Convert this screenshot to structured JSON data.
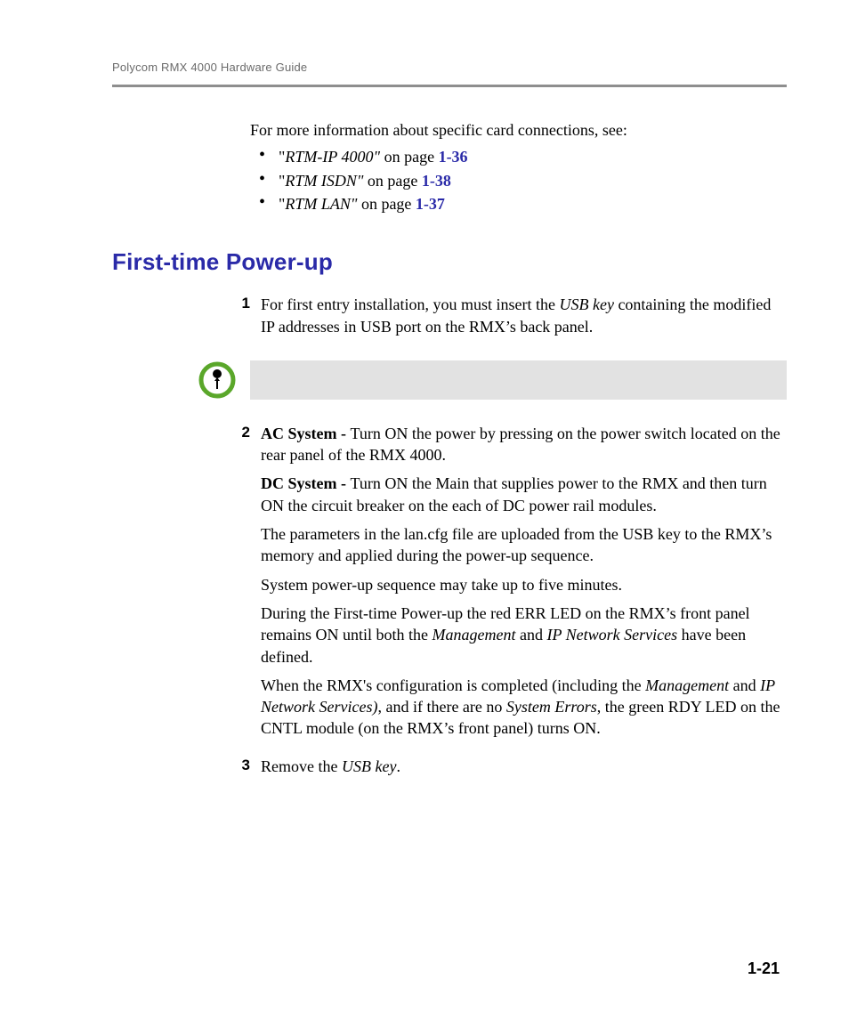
{
  "header": "Polycom RMX 4000 Hardware Guide",
  "intro": "For more information about specific card connections, see:",
  "refs": [
    {
      "prefix": "\"",
      "title": "RTM-IP 4000\"",
      "mid": " on page ",
      "page": "1-36"
    },
    {
      "prefix": "\"",
      "title": "RTM ISDN\"",
      "mid": " on page ",
      "page": "1-38"
    },
    {
      "prefix": "\"",
      "title": "RTM LAN\"",
      "mid": " on page ",
      "page": "1-37"
    }
  ],
  "heading": "First-time Power-up",
  "steps": {
    "one": {
      "num": "1",
      "a": "For first entry installation, you must insert the ",
      "b": "USB key",
      "c": " containing the modified IP addresses in USB port on the RMX’s back panel."
    },
    "two": {
      "num": "2",
      "ac_label": "AC System - ",
      "ac_text": "Turn ON the power by pressing on the power switch located on the rear panel of the RMX 4000.",
      "dc_label": "DC System - ",
      "dc_text": "Turn ON the Main that supplies power to the RMX and then turn ON the circuit breaker on the each of DC power rail modules.",
      "p3": "The parameters in the lan.cfg file are uploaded from the USB key to the RMX’s memory and applied during the power-up sequence.",
      "p4": "System power-up sequence may take up to five minutes.",
      "p5a": "During the First-time Power-up the red ERR LED on the RMX’s front panel remains ON until both the ",
      "p5b": "Management",
      "p5c": " and ",
      "p5d": "IP Network Services",
      "p5e": " have been defined.",
      "p6a": "When the RMX's configuration is completed (including the ",
      "p6b": "Management",
      "p6c": " and ",
      "p6d": "IP Network Services)",
      "p6e": ", and if there are no ",
      "p6f": "System Errors",
      "p6g": ", the green RDY LED on the CNTL module (on the RMX’s front panel) turns ON."
    },
    "three": {
      "num": "3",
      "a": "Remove the ",
      "b": "USB key",
      "c": "."
    }
  },
  "page_number": "1-21"
}
